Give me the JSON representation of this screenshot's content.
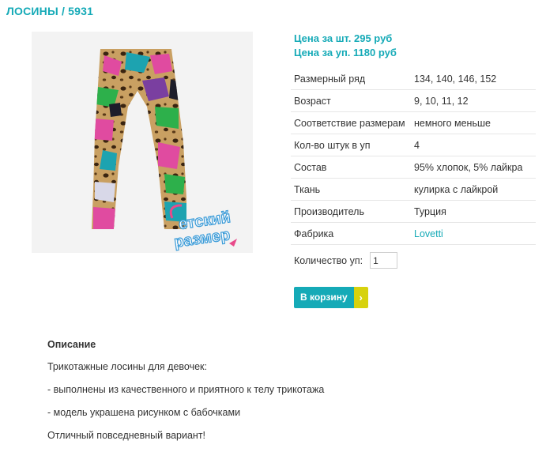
{
  "product": {
    "title": "ЛОСИНЫ / 5931",
    "image_alt": "leggings with butterfly print",
    "watermark": "Детский размер",
    "price_piece": "Цена за шт. 295 руб",
    "price_pack": "Цена за уп. 1180 руб"
  },
  "specs": [
    {
      "label": "Размерный ряд",
      "value": "134, 140, 146, 152"
    },
    {
      "label": "Возраст",
      "value": "9, 10, 11, 12"
    },
    {
      "label": "Соответствие размерам",
      "value": "немного меньше"
    },
    {
      "label": "Кол-во штук в уп",
      "value": "4"
    },
    {
      "label": "Состав",
      "value": "95% хлопок, 5% лайкра"
    },
    {
      "label": "Ткань",
      "value": "кулирка с лайкрой"
    },
    {
      "label": "Производитель",
      "value": "Турция"
    },
    {
      "label": "Фабрика",
      "value": "Lovetti"
    }
  ],
  "order": {
    "quantity_label": "Количество уп:",
    "quantity_value": "1",
    "cart_button": "В корзину",
    "cart_arrow": "›"
  },
  "description": {
    "heading": "Описание",
    "lines": [
      "Трикотажные лосины для девочек:",
      "- выполнены из качественного и приятного к телу трикотажа",
      "- модель украшена рисунком с бабочками",
      "Отличный повседневный вариант!"
    ]
  },
  "colors": {
    "accent": "#15aab7",
    "cart_arrow_bg": "#d7d20d"
  }
}
